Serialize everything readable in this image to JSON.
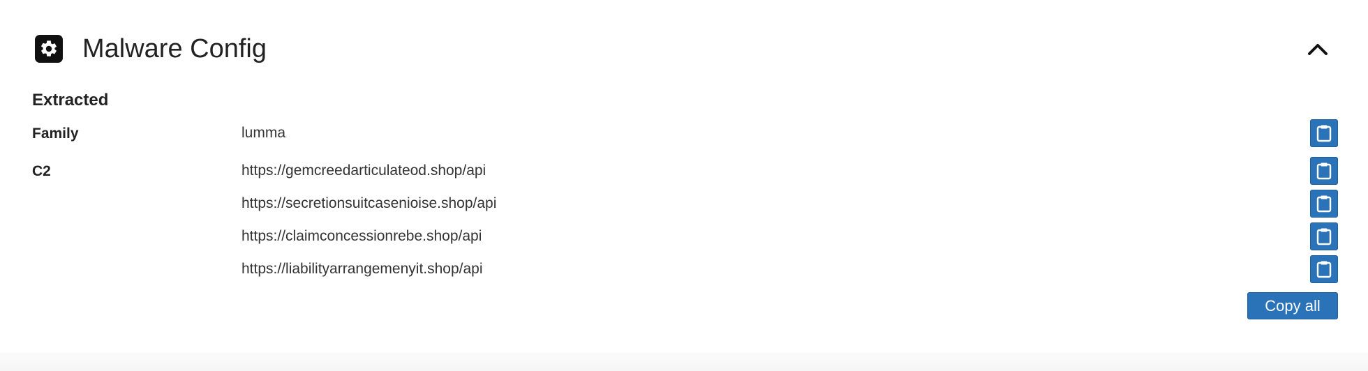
{
  "header": {
    "title": "Malware Config",
    "icon": "gear-icon",
    "collapse_icon": "chevron-up-icon"
  },
  "section": {
    "heading": "Extracted"
  },
  "rows": [
    {
      "label": "Family",
      "values": [
        "lumma"
      ]
    },
    {
      "label": "C2",
      "values": [
        "https://gemcreedarticulateod.shop/api",
        "https://secretionsuitcasenioise.shop/api",
        "https://claimconcessionrebe.shop/api",
        "https://liabilityarrangemenyit.shop/api"
      ]
    }
  ],
  "copy_button_icon": "clipboard-icon",
  "copy_all_label": "Copy all",
  "colors": {
    "accent": "#2a73b8",
    "text": "#222222"
  }
}
